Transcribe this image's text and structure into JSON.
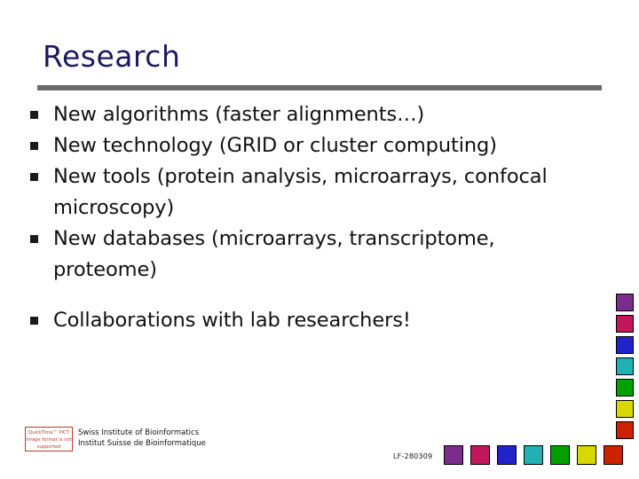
{
  "slide": {
    "title": "Research",
    "bullets": [
      {
        "text": "New algorithms (faster alignments…)",
        "spacer_before": false
      },
      {
        "text": "New technology (GRID or cluster computing)",
        "spacer_before": false
      },
      {
        "text": "New tools (protein analysis, microarrays, confocal microscopy)",
        "spacer_before": false
      },
      {
        "text": "New databases (microarrays, transcriptome, proteome)",
        "spacer_before": false
      },
      {
        "text": "Collaborations with lab researchers!",
        "spacer_before": true
      }
    ],
    "footer": {
      "org_line1": "Swiss Institute of Bioinformatics",
      "org_line2": "Institut Suisse de Bioinformatique",
      "broken_image_text": "QuickTime™ PICT Image format is not supported",
      "doc_code": "LF-280309"
    },
    "decoration": {
      "right_chip_colors": [
        "#7b2d8b",
        "#c2185b",
        "#2222cc",
        "#20b2b2",
        "#00a000",
        "#d8d800",
        "#cc2200"
      ],
      "bottom_chip_colors": [
        "#7b2d8b",
        "#c2185b",
        "#2222cc",
        "#20b2b2",
        "#00a000",
        "#d8d800",
        "#cc2200"
      ],
      "rule_color": "#6b6b6b",
      "title_color": "#1a1a5e"
    }
  }
}
